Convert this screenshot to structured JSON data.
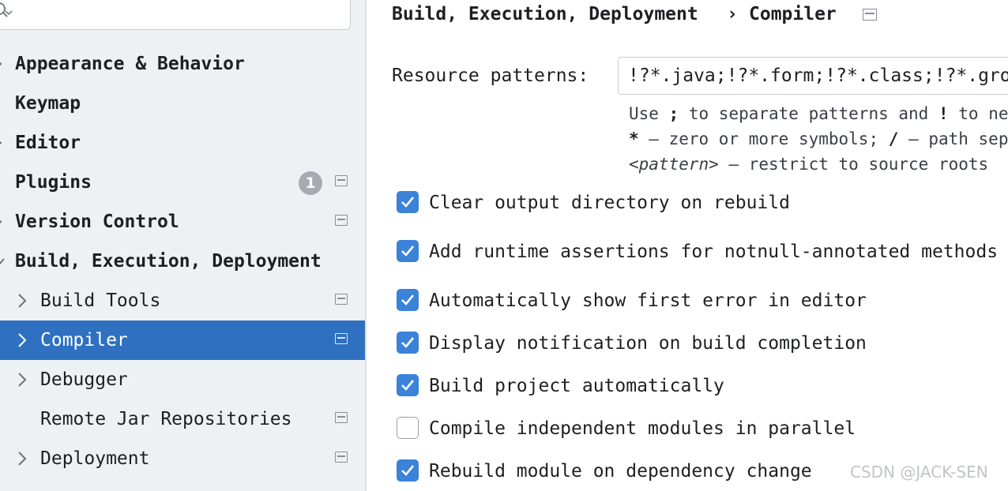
{
  "search": {
    "value": "",
    "placeholder": ""
  },
  "sidebar": {
    "items": [
      {
        "label": "Appearance & Behavior",
        "bold": true
      },
      {
        "label": "Keymap",
        "bold": true
      },
      {
        "label": "Editor",
        "bold": true
      },
      {
        "label": "Plugins",
        "bold": true,
        "badge": "1"
      },
      {
        "label": "Version Control",
        "bold": true
      },
      {
        "label": "Build, Execution, Deployment",
        "bold": true
      },
      {
        "label": "Build Tools"
      },
      {
        "label": "Compiler",
        "selected": true
      },
      {
        "label": "Debugger"
      },
      {
        "label": "Remote Jar Repositories"
      },
      {
        "label": "Deployment"
      }
    ]
  },
  "breadcrumb": {
    "parent": "Build, Execution, Deployment",
    "separator": "›",
    "current": "Compiler"
  },
  "resource_patterns": {
    "label": "Resource patterns:",
    "value": "!?*.java;!?*.form;!?*.class;!?*.groovy;!?*.scala;!?*.flex;!?*.kt;!?*.clj;!?*.aj",
    "hint_line1": {
      "a": "Use ",
      "b": ";",
      "c": " to separate patterns and ",
      "d": "!",
      "e": " to negate a pattern."
    },
    "hint_line2": {
      "a": "*",
      "b": " — zero or more symbols; ",
      "c": "/",
      "d": " — path separator;"
    },
    "hint_line3": {
      "a": "<pattern>",
      "b": " — restrict to source roots"
    }
  },
  "options": [
    {
      "label": "Clear output directory on rebuild",
      "checked": true
    },
    {
      "label": "Add runtime assertions for notnull-annotated methods and parameters",
      "checked": true
    },
    {
      "label": "Automatically show first error in editor",
      "checked": true
    },
    {
      "label": "Display notification on build completion",
      "checked": true
    },
    {
      "label": "Build project automatically",
      "checked": true
    },
    {
      "label": "Compile independent modules in parallel",
      "checked": false
    },
    {
      "label": "Rebuild module on dependency change",
      "checked": true
    }
  ],
  "watermark": "CSDN @JACK-SEN",
  "colors": {
    "selection": "#2f71c0",
    "checkbox": "#3b82d9",
    "sidebar_bg": "#eef1f4"
  }
}
